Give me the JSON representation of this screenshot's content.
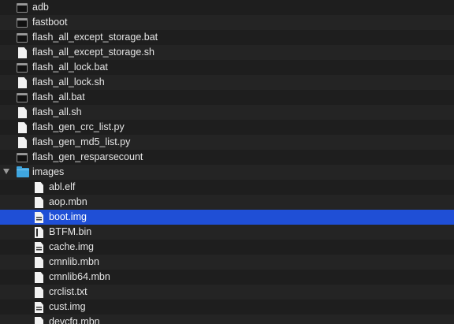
{
  "files": [
    {
      "name": "adb",
      "icon": "terminal-icon"
    },
    {
      "name": "fastboot",
      "icon": "terminal-icon"
    },
    {
      "name": "flash_all_except_storage.bat",
      "icon": "terminal-icon"
    },
    {
      "name": "flash_all_except_storage.sh",
      "icon": "document-icon"
    },
    {
      "name": "flash_all_lock.bat",
      "icon": "terminal-icon"
    },
    {
      "name": "flash_all_lock.sh",
      "icon": "document-icon"
    },
    {
      "name": "flash_all.bat",
      "icon": "terminal-icon"
    },
    {
      "name": "flash_all.sh",
      "icon": "document-icon"
    },
    {
      "name": "flash_gen_crc_list.py",
      "icon": "document-icon"
    },
    {
      "name": "flash_gen_md5_list.py",
      "icon": "document-icon"
    },
    {
      "name": "flash_gen_resparsecount",
      "icon": "terminal-icon"
    },
    {
      "name": "images",
      "icon": "folder-icon",
      "expanded": true
    },
    {
      "name": "abl.elf",
      "icon": "document-icon"
    },
    {
      "name": "aop.mbn",
      "icon": "document-icon"
    },
    {
      "name": "boot.img",
      "icon": "image-document-icon",
      "selected": true
    },
    {
      "name": "BTFM.bin",
      "icon": "binary-document-icon"
    },
    {
      "name": "cache.img",
      "icon": "image-document-icon"
    },
    {
      "name": "cmnlib.mbn",
      "icon": "document-icon"
    },
    {
      "name": "cmnlib64.mbn",
      "icon": "document-icon"
    },
    {
      "name": "crclist.txt",
      "icon": "document-icon"
    },
    {
      "name": "cust.img",
      "icon": "image-document-icon"
    },
    {
      "name": "devcfg.mbn",
      "icon": "document-icon"
    }
  ],
  "colors": {
    "background": "#1e1e1e",
    "row_alt": "#242424",
    "selection": "#1f4fd6",
    "folder": "#3fa6e0",
    "text": "#e6e6e6"
  }
}
